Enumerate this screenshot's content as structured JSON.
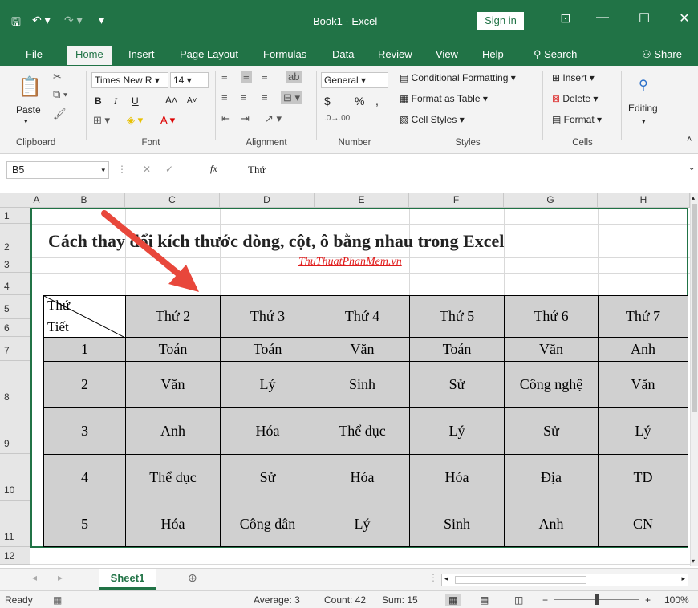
{
  "window": {
    "title": "Book1  -  Excel",
    "sign_in": "Sign in"
  },
  "tabs": [
    "File",
    "Home",
    "Insert",
    "Page Layout",
    "Formulas",
    "Data",
    "Review",
    "View",
    "Help"
  ],
  "search_label": "Search",
  "share_label": "Share",
  "ribbon": {
    "clipboard": {
      "label": "Clipboard",
      "paste": "Paste"
    },
    "font": {
      "label": "Font",
      "name": "Times New R",
      "size": "14",
      "bold": "B",
      "italic": "I",
      "underline": "U"
    },
    "alignment": {
      "label": "Alignment"
    },
    "number": {
      "label": "Number",
      "format": "General",
      "currency": "$",
      "percent": "%",
      "comma": ","
    },
    "styles": {
      "label": "Styles",
      "conditional": "Conditional Formatting",
      "format_table": "Format as Table",
      "cell_styles": "Cell Styles"
    },
    "cells": {
      "label": "Cells",
      "insert": "Insert",
      "delete": "Delete",
      "format": "Format"
    },
    "editing": {
      "label": "Editing"
    }
  },
  "formula_bar": {
    "name_box": "B5",
    "fx": "fx",
    "content": "Thứ"
  },
  "columns": [
    "A",
    "B",
    "C",
    "D",
    "E",
    "F",
    "G",
    "H"
  ],
  "rows": [
    "1",
    "2",
    "3",
    "4",
    "5",
    "6",
    "7",
    "8",
    "9",
    "10",
    "11",
    "12"
  ],
  "sheet": {
    "title": "Cách thay đổi kích thước dòng, cột, ô bằng nhau trong Excel",
    "subtitle": "ThuThuatPhanMem.vn",
    "corner_top": "Thứ",
    "corner_bottom": "Tiết",
    "header": [
      "Thứ 2",
      "Thứ 3",
      "Thứ 4",
      "Thứ 5",
      "Thứ 6",
      "Thứ 7"
    ],
    "body": [
      [
        "1",
        "Toán",
        "Toán",
        "Văn",
        "Toán",
        "Văn",
        "Anh"
      ],
      [
        "2",
        "Văn",
        "Lý",
        "Sinh",
        "Sử",
        "Công nghệ",
        "Văn"
      ],
      [
        "3",
        "Anh",
        "Hóa",
        "Thể dục",
        "Lý",
        "Sử",
        "Lý"
      ],
      [
        "4",
        "Thể dục",
        "Sử",
        "Hóa",
        "Hóa",
        "Địa",
        "TD"
      ],
      [
        "5",
        "Hóa",
        "Công dân",
        "Lý",
        "Sinh",
        "Anh",
        "CN"
      ]
    ]
  },
  "sheet_tab": "Sheet1",
  "status": {
    "ready": "Ready",
    "average": "Average: 3",
    "count": "Count: 42",
    "sum": "Sum: 15",
    "zoom": "100%"
  },
  "colors": {
    "excel_green": "#217346",
    "table_fill": "#d0d0d0",
    "arrow": "#e8473b",
    "subtitle": "#e01b1b"
  }
}
